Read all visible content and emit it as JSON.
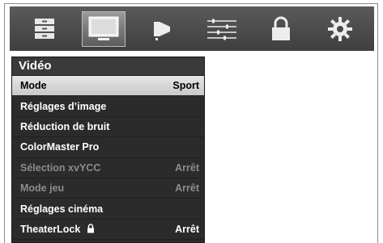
{
  "icons": [
    {
      "name": "list-icon",
      "active": false
    },
    {
      "name": "tv-picture-icon",
      "active": true
    },
    {
      "name": "speaker-icon",
      "active": false
    },
    {
      "name": "equalizer-icon",
      "active": false
    },
    {
      "name": "lock-icon",
      "active": false
    },
    {
      "name": "gear-icon",
      "active": false
    }
  ],
  "menu": {
    "title": "Vidéo",
    "items": [
      {
        "label": "Mode",
        "value": "Sport"
      },
      {
        "label": "Réglages d’image",
        "value": ""
      },
      {
        "label": "Réduction de bruit",
        "value": ""
      },
      {
        "label": "ColorMaster Pro",
        "value": ""
      },
      {
        "label": "Sélection xvYCC",
        "value": "Arrêt"
      },
      {
        "label": "Mode jeu",
        "value": "Arrêt"
      },
      {
        "label": "Réglages cinéma",
        "value": ""
      },
      {
        "label": "TheaterLock",
        "value": "Arrêt"
      }
    ]
  },
  "colors": {
    "bar": "#4a4a4a",
    "menu_bg": "#2b2b2b",
    "selected_bg": "#d6d6d6",
    "disabled_text": "#8c8c8c"
  }
}
